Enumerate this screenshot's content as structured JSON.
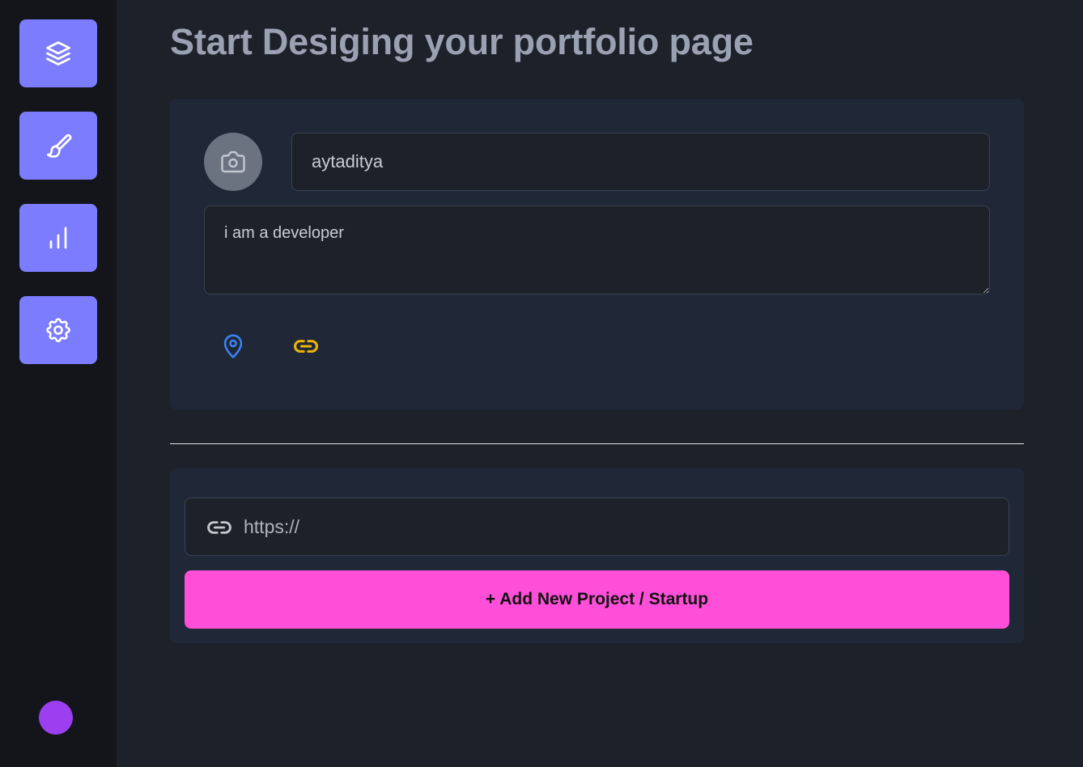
{
  "sidebar": {
    "items": [
      {
        "name": "layers",
        "icon": "layers-icon"
      },
      {
        "name": "design",
        "icon": "brush-icon"
      },
      {
        "name": "analytics",
        "icon": "bar-chart-icon"
      },
      {
        "name": "settings",
        "icon": "gear-icon"
      }
    ],
    "accent_color": "#7c7cff",
    "avatar_color": "#9b3ff0"
  },
  "page": {
    "title": "Start Desiging your portfolio page"
  },
  "profile": {
    "photo_icon": "camera-icon",
    "name_value": "aytaditya",
    "bio_value": "i am a developer",
    "location_icon": "map-pin-icon",
    "location_color": "#3b82f6",
    "link_icon": "link-icon",
    "link_color": "#eab308"
  },
  "project": {
    "url_icon": "link-icon",
    "url_placeholder": "https://",
    "add_button_label": "+ Add New Project / Startup",
    "add_button_color": "#ff4fd8"
  }
}
